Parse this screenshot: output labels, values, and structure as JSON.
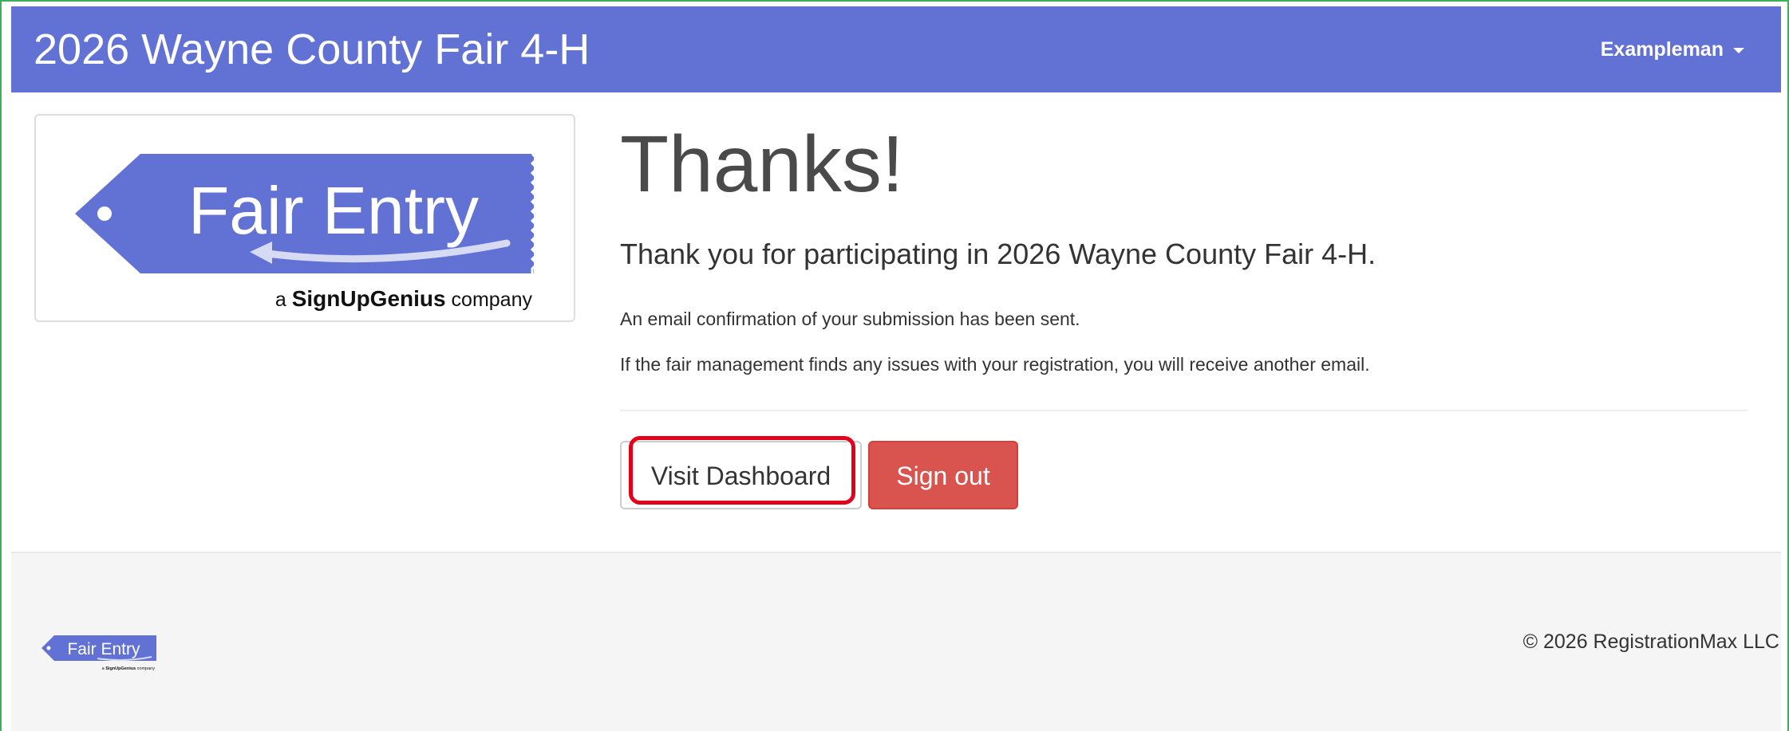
{
  "navbar": {
    "brand": "2026 Wayne County Fair 4-H",
    "user_name": "Exampleman",
    "user_menu_icon": "caret-down-icon",
    "background_color": "#6272d4"
  },
  "logo": {
    "text": "Fair Entry",
    "tagline_prefix": "a",
    "tagline_brand": "SignUpGenius",
    "tagline_suffix": "company",
    "tag_color": "#6272d4"
  },
  "main": {
    "heading": "Thanks!",
    "lead": "Thank you for participating in 2026 Wayne County Fair 4-H.",
    "paragraphs": [
      "An email confirmation of your submission has been sent.",
      "If the fair management finds any issues with your registration, you will receive another email."
    ],
    "buttons": {
      "dashboard_label": "Visit Dashboard",
      "signout_label": "Sign out"
    },
    "colors": {
      "danger": "#d9534f",
      "highlight": "#e3001b"
    }
  },
  "footer": {
    "copyright": "© 2026 RegistrationMax LLC"
  }
}
